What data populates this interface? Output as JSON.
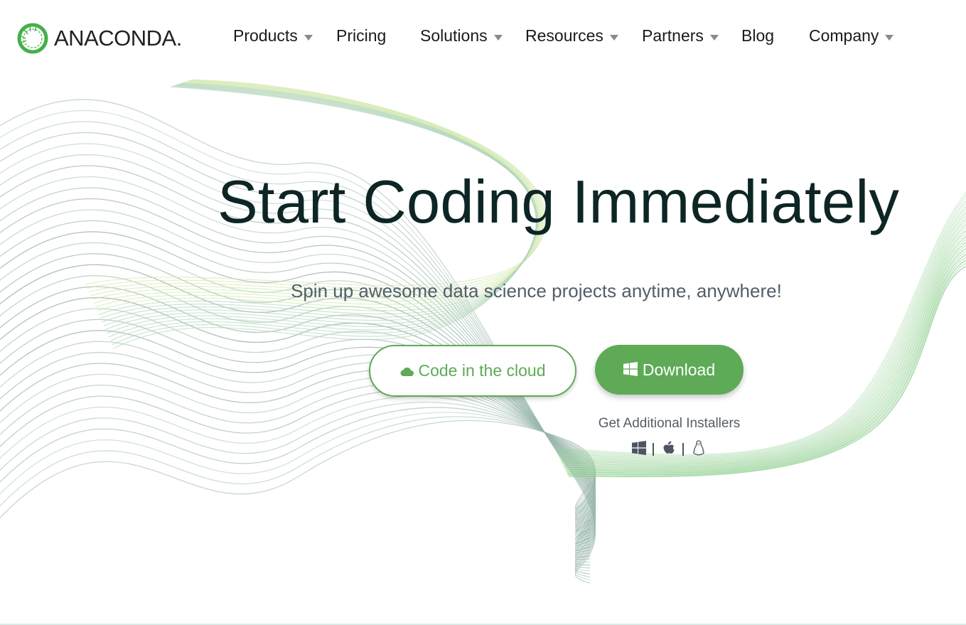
{
  "brand": {
    "name": "ANACONDA",
    "dot": ".",
    "logo_icon": "anaconda-ring-icon",
    "accent_color": "#5eaa56"
  },
  "nav": {
    "items": [
      {
        "label": "Products",
        "has_dropdown": true
      },
      {
        "label": "Pricing",
        "has_dropdown": false
      },
      {
        "label": "Solutions",
        "has_dropdown": true
      },
      {
        "label": "Resources",
        "has_dropdown": true
      },
      {
        "label": "Partners",
        "has_dropdown": true
      },
      {
        "label": "Blog",
        "has_dropdown": false
      },
      {
        "label": "Company",
        "has_dropdown": true
      }
    ]
  },
  "hero": {
    "title": "Start Coding Immediately",
    "subtitle": "Spin up awesome data science projects anytime, anywhere!",
    "cloud_button": {
      "label": "Code in the cloud",
      "icon": "cloud-icon"
    },
    "download_button": {
      "label": "Download",
      "icon": "windows-icon"
    },
    "installers": {
      "label": "Get Additional Installers",
      "platforms": [
        {
          "icon": "windows-icon"
        },
        {
          "icon": "apple-icon"
        },
        {
          "icon": "linux-icon"
        }
      ]
    }
  }
}
